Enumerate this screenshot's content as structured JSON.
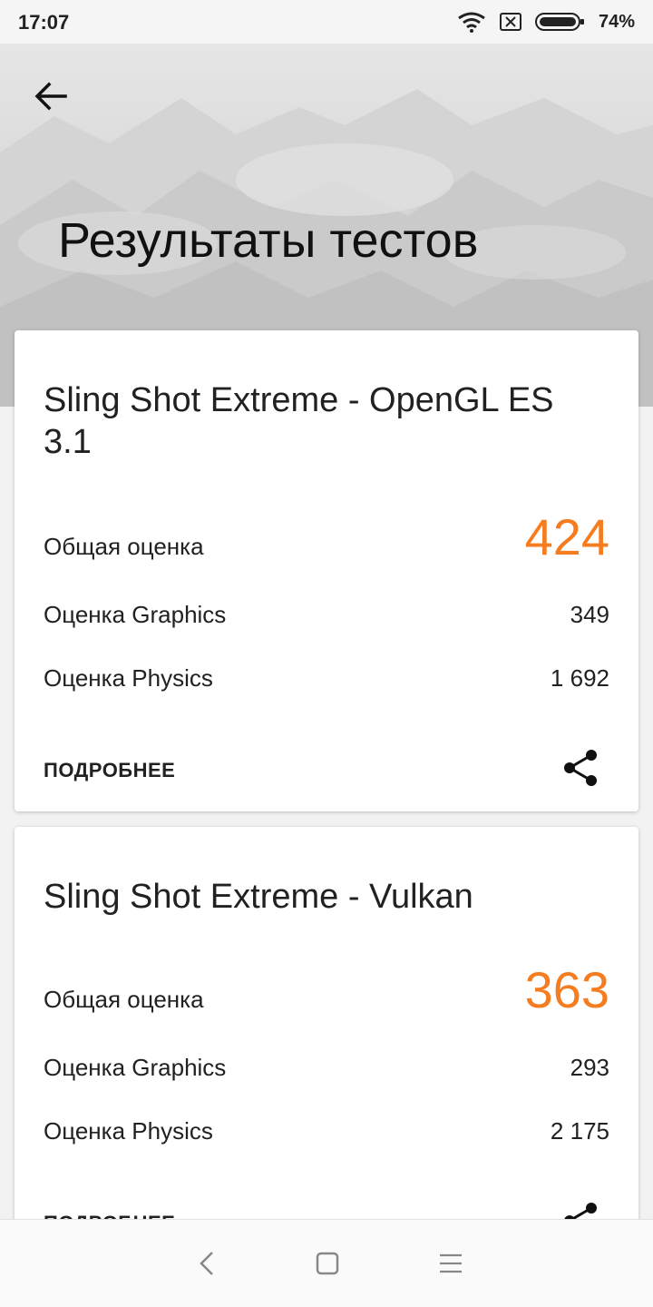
{
  "status_bar": {
    "time": "17:07",
    "battery_percent": "74%",
    "battery_level": 0.74,
    "icons": [
      "wifi-icon",
      "no-sim-icon",
      "battery-icon"
    ]
  },
  "header": {
    "title": "Результаты тестов",
    "back_icon": "arrow-left-icon"
  },
  "cards": [
    {
      "title": "Sling Shot Extreme - OpenGL ES 3.1",
      "total_label": "Общая оценка",
      "total_value": "424",
      "graphics_label": "Оценка Graphics",
      "graphics_value": "349",
      "physics_label": "Оценка Physics",
      "physics_value": "1 692",
      "more_label": "ПОДРОБНЕЕ",
      "share_icon": "share-icon"
    },
    {
      "title": "Sling Shot Extreme - Vulkan",
      "total_label": "Общая оценка",
      "total_value": "363",
      "graphics_label": "Оценка Graphics",
      "graphics_value": "293",
      "physics_label": "Оценка Physics",
      "physics_value": "2 175",
      "more_label": "ПОДРОБНЕЕ",
      "share_icon": "share-icon"
    }
  ],
  "nav_bar": {
    "icons": [
      "nav-back-icon",
      "nav-home-icon",
      "nav-menu-icon"
    ]
  },
  "colors": {
    "accent": "#f57c1f",
    "text": "#212121",
    "card": "#ffffff",
    "background": "#f2f2f2"
  }
}
